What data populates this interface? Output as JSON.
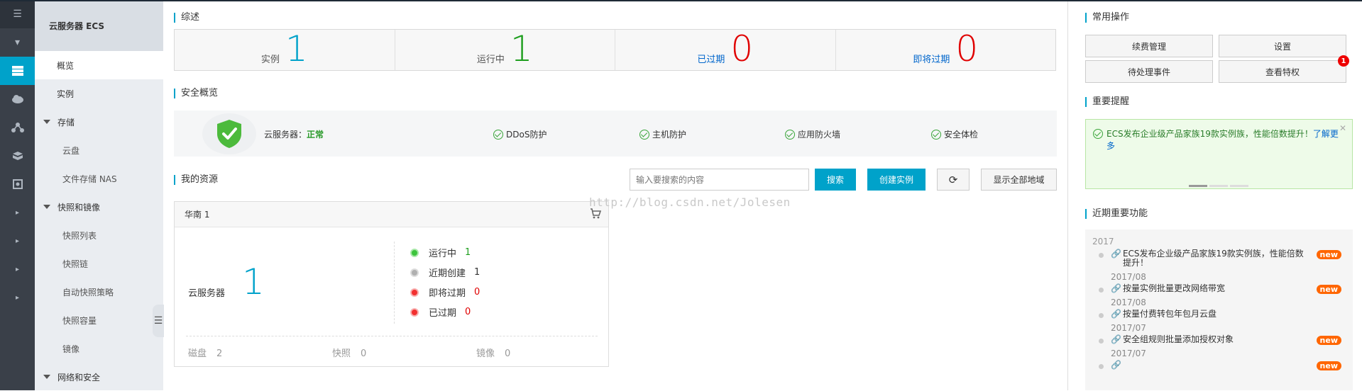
{
  "rail": {
    "icons": [
      "menu-icon",
      "chevron-down-icon",
      "server-icon",
      "cloud-icon",
      "network-icon",
      "storage-icon",
      "security-icon",
      "chevron-right-icon",
      "chevron-right-icon",
      "chevron-right-icon",
      "chevron-right-icon"
    ]
  },
  "sidebar": {
    "header": "云服务器 ECS",
    "items": [
      {
        "label": "概览",
        "type": "active"
      },
      {
        "label": "实例",
        "type": "item"
      },
      {
        "label": "存储",
        "type": "group"
      },
      {
        "label": "云盘",
        "type": "sub"
      },
      {
        "label": "文件存储 NAS",
        "type": "sub"
      },
      {
        "label": "快照和镜像",
        "type": "group"
      },
      {
        "label": "快照列表",
        "type": "sub"
      },
      {
        "label": "快照链",
        "type": "sub"
      },
      {
        "label": "自动快照策略",
        "type": "sub"
      },
      {
        "label": "快照容量",
        "type": "sub"
      },
      {
        "label": "镜像",
        "type": "sub"
      },
      {
        "label": "网络和安全",
        "type": "group"
      }
    ]
  },
  "overview": {
    "title": "综述",
    "cells": [
      {
        "label": "实例",
        "value": "1",
        "color": "#00a2ca",
        "link": false
      },
      {
        "label": "运行中",
        "value": "1",
        "color": "#1e9e1e",
        "link": false
      },
      {
        "label": "已过期",
        "value": "0",
        "color": "#e00000",
        "link": true
      },
      {
        "label": "即将过期",
        "value": "0",
        "color": "#e00000",
        "link": true
      }
    ]
  },
  "security": {
    "title": "安全概览",
    "server_label": "云服务器：",
    "server_status": "正常",
    "checks": [
      "DDoS防护",
      "主机防护",
      "应用防火墙",
      "安全体检"
    ]
  },
  "resources": {
    "title": "我的资源",
    "search_placeholder": "输入要搜索的内容",
    "search_button": "搜索",
    "create_button": "创建实例",
    "all_regions_button": "显示全部地域",
    "region": {
      "name": "华南 1",
      "server_label": "云服务器",
      "server_count": "1",
      "statuses": [
        {
          "label": "运行中",
          "value": "1",
          "dot": "#3cc43c",
          "val_color": "#1e9e1e"
        },
        {
          "label": "近期创建",
          "value": "1",
          "dot": "#b0b0b0",
          "val_color": "#333333"
        },
        {
          "label": "即将过期",
          "value": "0",
          "dot": "#f23030",
          "val_color": "#e00000"
        },
        {
          "label": "已过期",
          "value": "0",
          "dot": "#f23030",
          "val_color": "#e00000"
        }
      ],
      "bottom": [
        {
          "label": "磁盘",
          "value": "2"
        },
        {
          "label": "快照",
          "value": "0"
        },
        {
          "label": "镜像",
          "value": "0"
        }
      ]
    }
  },
  "watermark": "http://blog.csdn.net/Jolesen",
  "ops": {
    "title": "常用操作",
    "buttons": [
      "续费管理",
      "设置",
      "待处理事件",
      "查看特权"
    ],
    "badge": "1"
  },
  "notice": {
    "title": "重要提醒",
    "text": "ECS发布企业级产品家族19款实例族，性能倍数提升！",
    "more": "了解更多"
  },
  "recent": {
    "title": "近期重要功能",
    "year": "2017",
    "items": [
      {
        "title": "ECS发布企业级产品家族19款实例族，性能倍数提升！",
        "date": "2017/08",
        "new": true
      },
      {
        "title": "按量实例批量更改网络带宽",
        "date": "2017/08",
        "new": true
      },
      {
        "title": "按量付费转包年包月云盘",
        "date": "2017/07",
        "new": false
      },
      {
        "title": "安全组规则批量添加授权对象",
        "date": "2017/07",
        "new": true
      },
      {
        "title": "",
        "date": "",
        "new": true
      }
    ],
    "new_label": "new"
  }
}
